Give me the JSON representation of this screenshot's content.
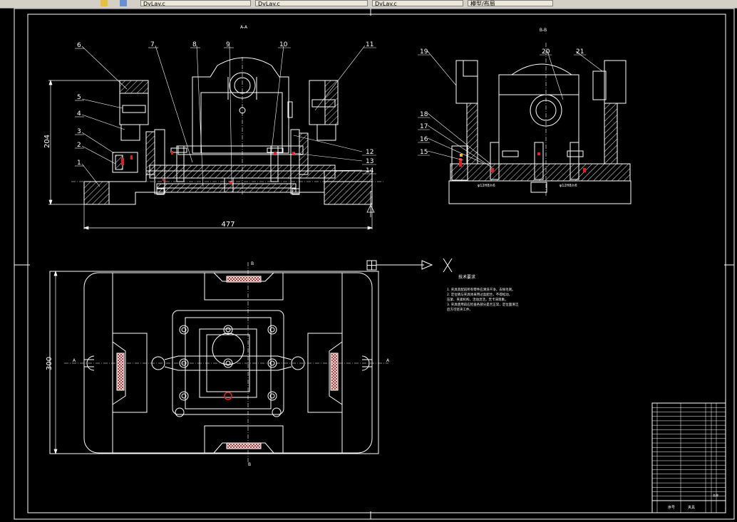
{
  "toolbar": {
    "tabs": [
      "DyLay.c",
      "DyLay.c",
      "DyLay.c",
      "模型/布局"
    ]
  },
  "views": {
    "section_aa": "A-A",
    "section_bb": "B-B"
  },
  "dimensions": {
    "height_left": "204",
    "width_bottom": "477",
    "plan_height": "300"
  },
  "balloons": [
    "1",
    "2",
    "3",
    "4",
    "5",
    "6",
    "7",
    "8",
    "9",
    "10",
    "11",
    "12",
    "13",
    "14",
    "15",
    "16",
    "17",
    "18",
    "19",
    "20",
    "21"
  ],
  "fit_labels": [
    "φ12H8/n6",
    "φ12H8/n6"
  ],
  "section_marks": {
    "A_left": "A",
    "A_right": "A",
    "B_top": "B",
    "B_bottom": "B"
  },
  "technical_requirements": {
    "title": "技术要求",
    "lines": [
      "1. 夹具装配前所有零件应清洗干净，去除毛刺。",
      "2. 定位销与夹具体采用过盈配合，不得松动，",
      "   压紧、夹紧机构，活动灵活，无卡滞现象。",
      "3. 夹具使用前应检查各部分是否正常，定位面清洁",
      "   后方可装夹工件。"
    ]
  },
  "title_block": {
    "name": "夹具",
    "footer_left": "序号",
    "footer_right": "名称"
  }
}
